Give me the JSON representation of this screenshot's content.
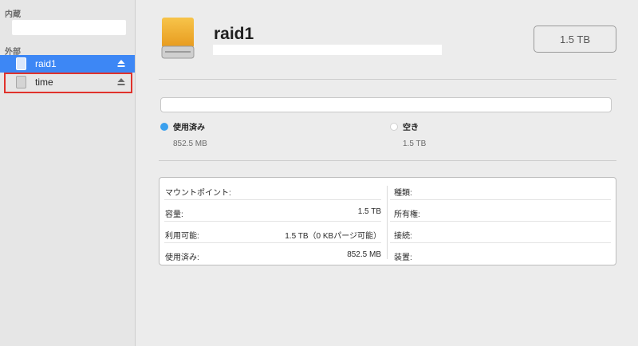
{
  "sidebar": {
    "internal_label": "内蔵",
    "external_label": "外部",
    "items": [
      {
        "label": "raid1",
        "selected": true
      },
      {
        "label": "time",
        "selected": false
      }
    ]
  },
  "volume": {
    "name": "raid1",
    "capacity_badge": "1.5 TB",
    "used_label": "使用済み",
    "used_value": "852.5 MB",
    "free_label": "空き",
    "free_value": "1.5 TB",
    "used_fraction": 0.0006
  },
  "info": {
    "left": [
      {
        "key": "マウントポイント:",
        "value": ""
      },
      {
        "key": "容量:",
        "value": "1.5 TB"
      },
      {
        "key": "利用可能:",
        "value": "1.5 TB（0 KBパージ可能）"
      },
      {
        "key": "使用済み:",
        "value": "852.5 MB"
      }
    ],
    "right": [
      {
        "key": "種類:",
        "value": ""
      },
      {
        "key": "所有権:",
        "value": ""
      },
      {
        "key": "接続:",
        "value": ""
      },
      {
        "key": "装置:",
        "value": ""
      }
    ]
  },
  "colors": {
    "accent": "#3d87f5",
    "used": "#3aa0ee",
    "highlight": "#e0322b"
  }
}
